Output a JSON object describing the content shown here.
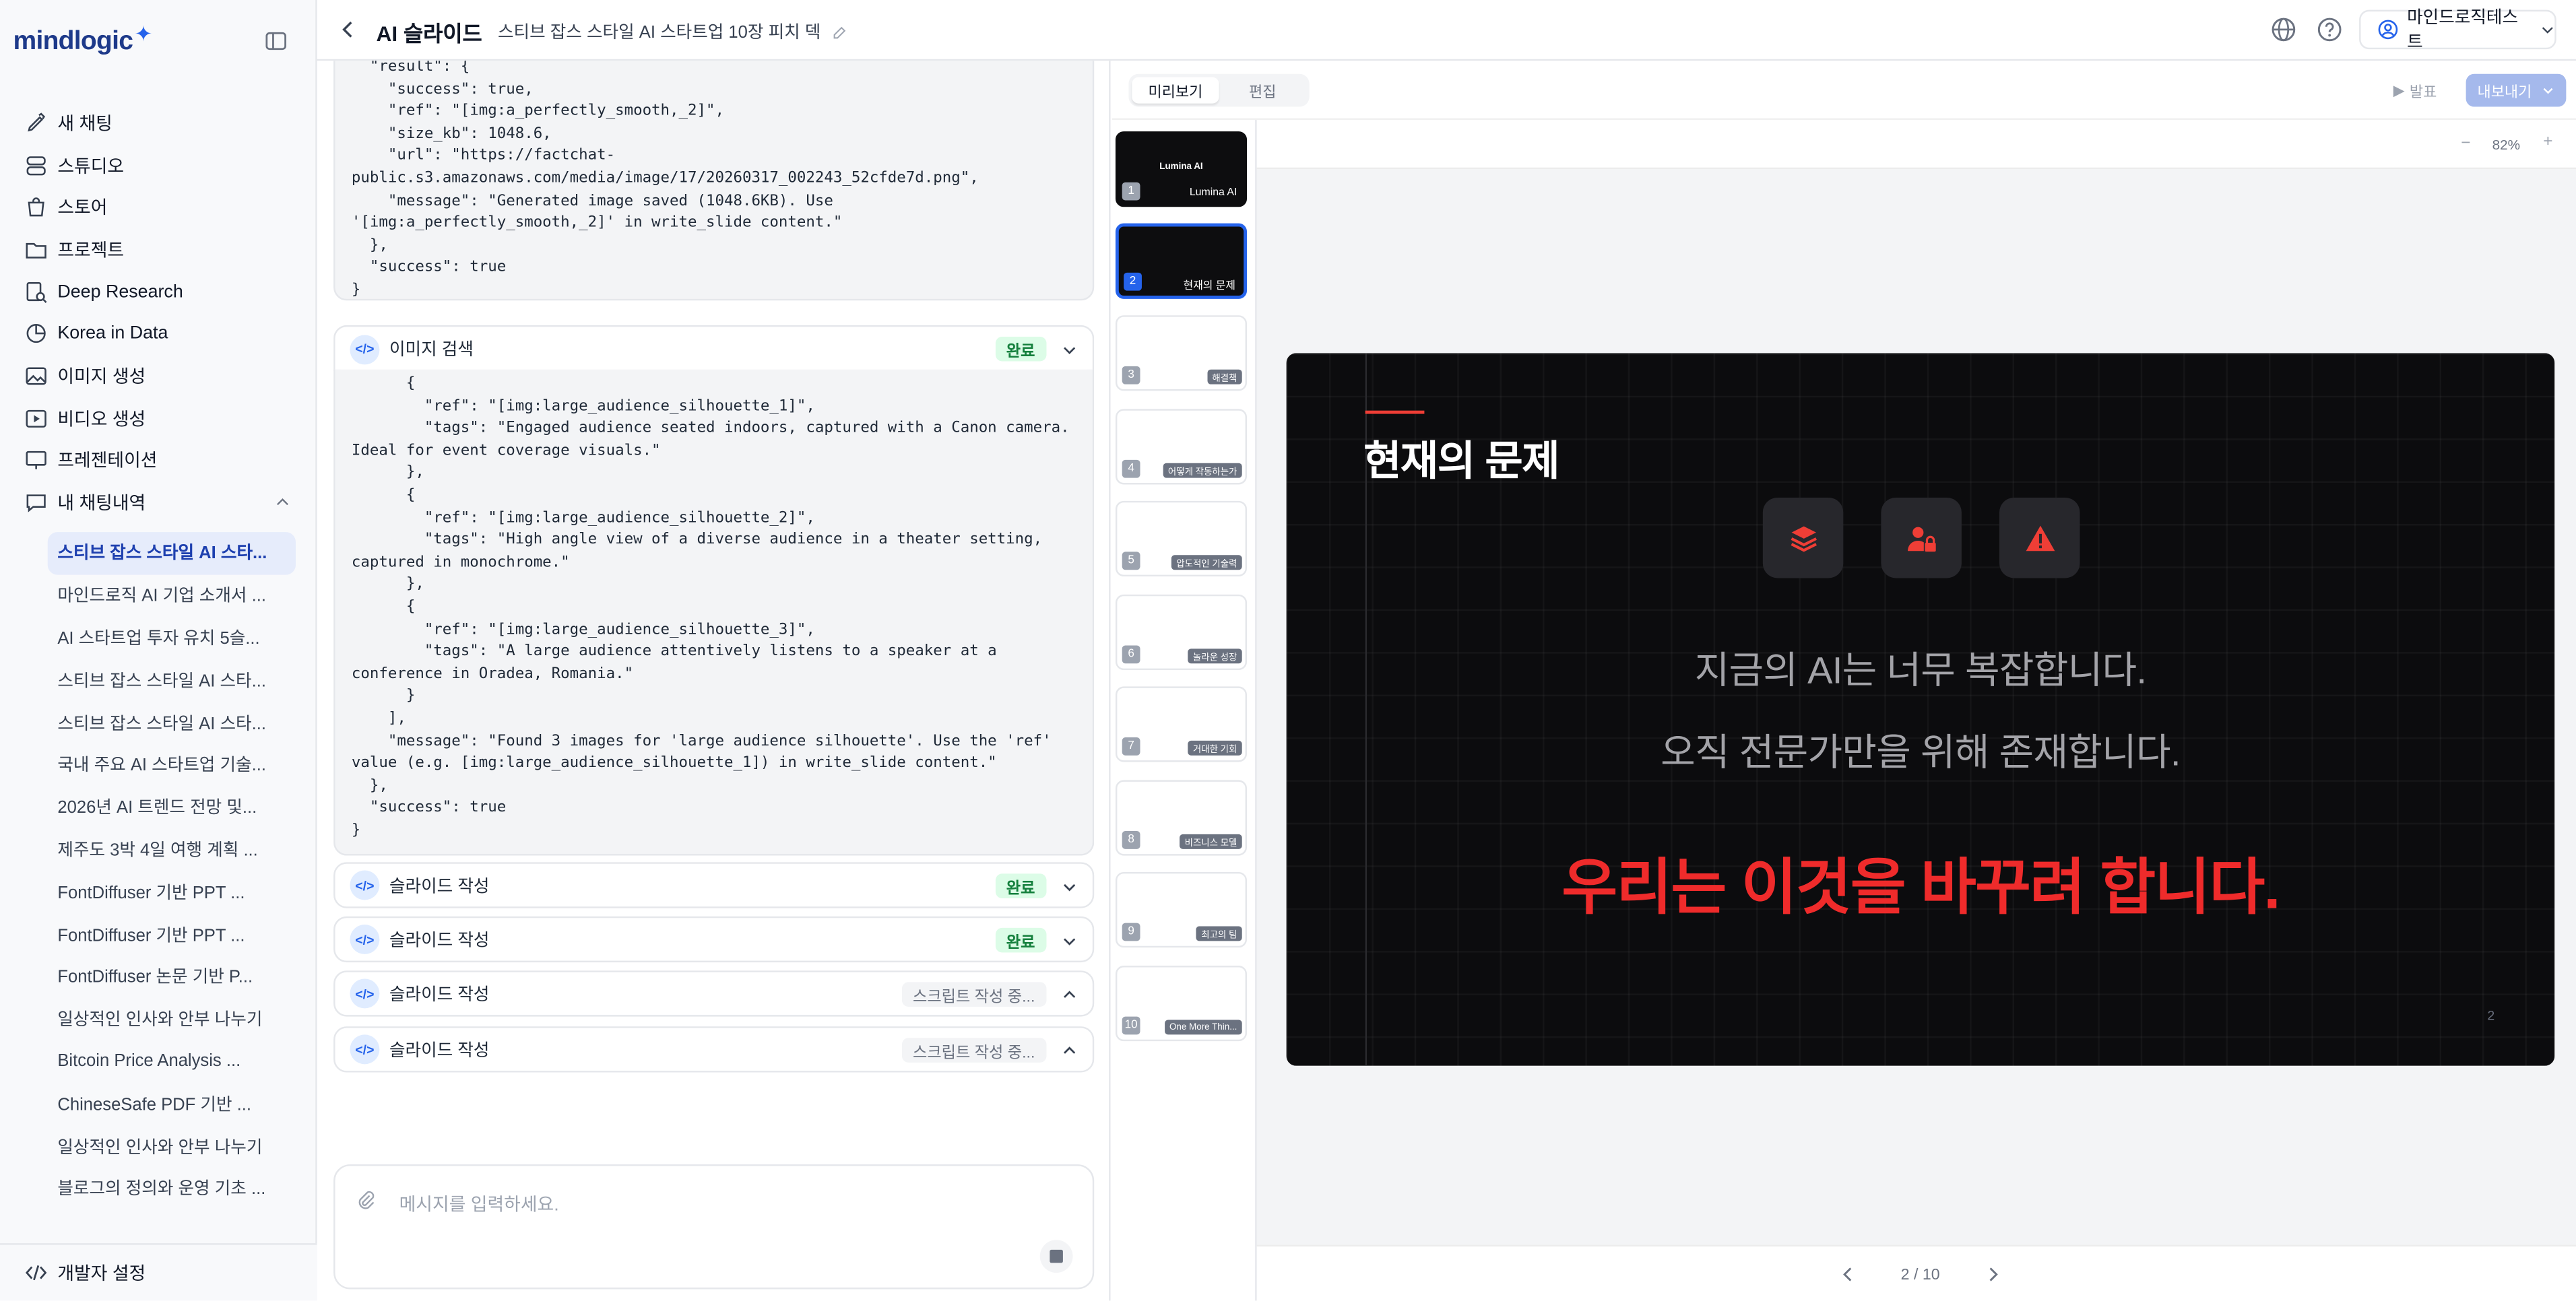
{
  "brand": {
    "name": "mindlogic",
    "accent": "#2563eb"
  },
  "sidebar": {
    "nav": [
      {
        "label": "새 채팅",
        "icon": "new-chat-icon"
      },
      {
        "label": "스튜디오",
        "icon": "studio-icon"
      },
      {
        "label": "스토어",
        "icon": "store-icon"
      },
      {
        "label": "프로젝트",
        "icon": "folder-icon"
      },
      {
        "label": "Deep Research",
        "icon": "deep-research-icon"
      },
      {
        "label": "Korea in Data",
        "icon": "chart-icon"
      },
      {
        "label": "이미지 생성",
        "icon": "image-icon"
      },
      {
        "label": "비디오 생성",
        "icon": "video-icon"
      },
      {
        "label": "프레젠테이션",
        "icon": "presentation-icon"
      },
      {
        "label": "내 채팅내역",
        "icon": "chat-history-icon"
      }
    ],
    "history": [
      "스티브 잡스 스타일 AI 스타...",
      "마인드로직 AI 기업 소개서 ...",
      "AI 스타트업 투자 유치 5슬...",
      "스티브 잡스 스타일 AI 스타...",
      "스티브 잡스 스타일 AI 스타...",
      "국내 주요 AI 스타트업 기술...",
      "2026년 AI 트렌드 전망 및...",
      "제주도 3박 4일 여행 계획 ...",
      "FontDiffuser 기반 PPT ...",
      "FontDiffuser 기반 PPT ...",
      "FontDiffuser 논문 기반 P...",
      "일상적인 인사와 안부 나누기",
      "Bitcoin Price Analysis ...",
      "ChineseSafe PDF 기반 ...",
      "일상적인 인사와 안부 나누기",
      "블로그의 정의와 운영 기초 ..."
    ],
    "dev_settings": "개발자 설정"
  },
  "topbar": {
    "app_title": "AI 슬라이드",
    "doc_title": "스티브 잡스 스타일 AI 스타트업 10장 피치 덱",
    "user": "마인드로직테스트"
  },
  "chat": {
    "code1": "  \"result\": {\n    \"success\": true,\n    \"ref\": \"[img:a_perfectly_smooth,_2]\",\n    \"size_kb\": 1048.6,\n    \"url\": \"https://factchat-\npublic.s3.amazonaws.com/media/image/17/20260317_002243_52cfde7d.png\",\n    \"message\": \"Generated image saved (1048.6KB). Use\n'[img:a_perfectly_smooth,_2]' in write_slide content.\"\n  },\n  \"success\": true\n}",
    "tools": [
      {
        "label": "이미지 검색",
        "status": "완료",
        "state": "done"
      },
      {
        "label": "슬라이드 작성",
        "status": "완료",
        "state": "done"
      },
      {
        "label": "슬라이드 작성",
        "status": "완료",
        "state": "done"
      },
      {
        "label": "슬라이드 작성",
        "status": "스크립트 작성 중...",
        "state": "progress"
      },
      {
        "label": "슬라이드 작성",
        "status": "스크립트 작성 중...",
        "state": "progress"
      }
    ],
    "code2": "      {\n        \"ref\": \"[img:large_audience_silhouette_1]\",\n        \"tags\": \"Engaged audience seated indoors, captured with a Canon camera.\nIdeal for event coverage visuals.\"\n      },\n      {\n        \"ref\": \"[img:large_audience_silhouette_2]\",\n        \"tags\": \"High angle view of a diverse audience in a theater setting,\ncaptured in monochrome.\"\n      },\n      {\n        \"ref\": \"[img:large_audience_silhouette_3]\",\n        \"tags\": \"A large audience attentively listens to a speaker at a\nconference in Oradea, Romania.\"\n      }\n    ],\n    \"message\": \"Found 3 images for 'large audience silhouette'. Use the 'ref'\nvalue (e.g. [img:large_audience_silhouette_1]) in write_slide content.\"\n  },\n  \"success\": true\n}",
    "input_placeholder": "메시지를 입력하세요."
  },
  "strip": {
    "thumbs": [
      {
        "n": "1",
        "label": "Lumina AI",
        "center": "Lumina AI",
        "theme": "dark"
      },
      {
        "n": "2",
        "label": "현재의 문제",
        "center": "",
        "theme": "selected"
      },
      {
        "n": "3",
        "label": "해결책",
        "center": "",
        "theme": "light"
      },
      {
        "n": "4",
        "label": "어떻게 작동하는가",
        "center": "",
        "theme": "light"
      },
      {
        "n": "5",
        "label": "압도적인 기술력",
        "center": "",
        "theme": "light"
      },
      {
        "n": "6",
        "label": "놀라운 성장",
        "center": "",
        "theme": "light"
      },
      {
        "n": "7",
        "label": "거대한 기회",
        "center": "",
        "theme": "light"
      },
      {
        "n": "8",
        "label": "비즈니스 모델",
        "center": "",
        "theme": "light"
      },
      {
        "n": "9",
        "label": "최고의 팀",
        "center": "",
        "theme": "light"
      },
      {
        "n": "10",
        "label": "One More Thin...",
        "center": "",
        "theme": "light"
      }
    ]
  },
  "preview": {
    "tab_preview": "미리보기",
    "tab_edit": "편집",
    "present": "발표",
    "export": "내보내기",
    "zoom": "82%",
    "page": "2 / 10"
  },
  "slide": {
    "title": "현재의 문제",
    "line1": "지금의 AI는 너무 복잡합니다.",
    "line2": "오직 전문가만을 위해 존재합니다.",
    "emphasis": "우리는 이것을 바꾸려 합니다.",
    "page_no": "2",
    "icons": [
      "layers-icon",
      "user-lock-icon",
      "warning-icon"
    ],
    "accent_color": "#ef2b2b"
  }
}
